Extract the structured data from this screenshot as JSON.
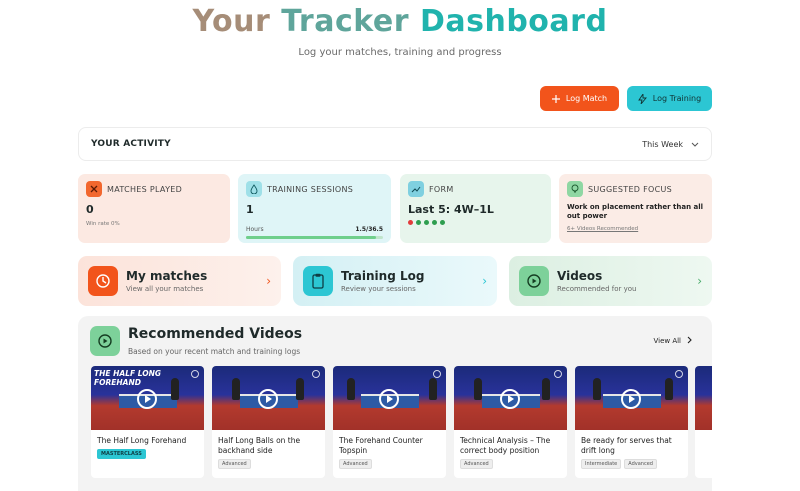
{
  "header": {
    "title_part1": "Your",
    "title_part2": "Tracker",
    "title_part3": "Dashboard",
    "subtitle": "Log your matches, training and progress"
  },
  "actions": {
    "log_match": "Log Match",
    "log_training": "Log Training"
  },
  "activity": {
    "title": "YOUR ACTIVITY",
    "period": "This Week"
  },
  "stats": {
    "matches": {
      "label": "MATCHES PLAYED",
      "value": "0",
      "note": "Win rate 0%"
    },
    "training": {
      "label": "TRAINING SESSIONS",
      "value": "1",
      "hours_label": "Hours",
      "hours_value": "1.5/36.5",
      "progress": 0.95
    },
    "form": {
      "label": "FORM",
      "value": "Last 5: 4W–1L",
      "results": [
        "L",
        "W",
        "W",
        "W",
        "W"
      ]
    },
    "focus": {
      "label": "SUGGESTED FOCUS",
      "text": "Work on placement rather than all out power",
      "link": "6+ Videos Recommended"
    }
  },
  "nav": {
    "matches": {
      "title": "My matches",
      "subtitle": "View all your matches"
    },
    "training": {
      "title": "Training Log",
      "subtitle": "Review your sessions"
    },
    "videos": {
      "title": "Videos",
      "subtitle": "Recommended for you"
    }
  },
  "recommended": {
    "title": "Recommended Videos",
    "subtitle": "Based on your recent match and training logs",
    "view_all": "View All",
    "videos": [
      {
        "title": "The Half Long Forehand",
        "overlay": "THE HALF LONG FOREHAND",
        "tags": [
          "MASTERCLASS"
        ]
      },
      {
        "title": "Half Long Balls on the backhand side",
        "overlay": "",
        "tags": [
          "Advanced"
        ]
      },
      {
        "title": "The Forehand Counter Topspin",
        "overlay": "",
        "tags": [
          "Advanced"
        ]
      },
      {
        "title": "Technical Analysis – The correct body position",
        "overlay": "",
        "tags": [
          "Advanced"
        ]
      },
      {
        "title": "Be ready for serves that drift long",
        "overlay": "",
        "tags": [
          "Intermediate",
          "Advanced"
        ]
      }
    ]
  },
  "colors": {
    "accent_orange": "#f2541b",
    "accent_teal": "#2cc6d3",
    "win": "#2e9e4f",
    "loss": "#e23b3b"
  }
}
